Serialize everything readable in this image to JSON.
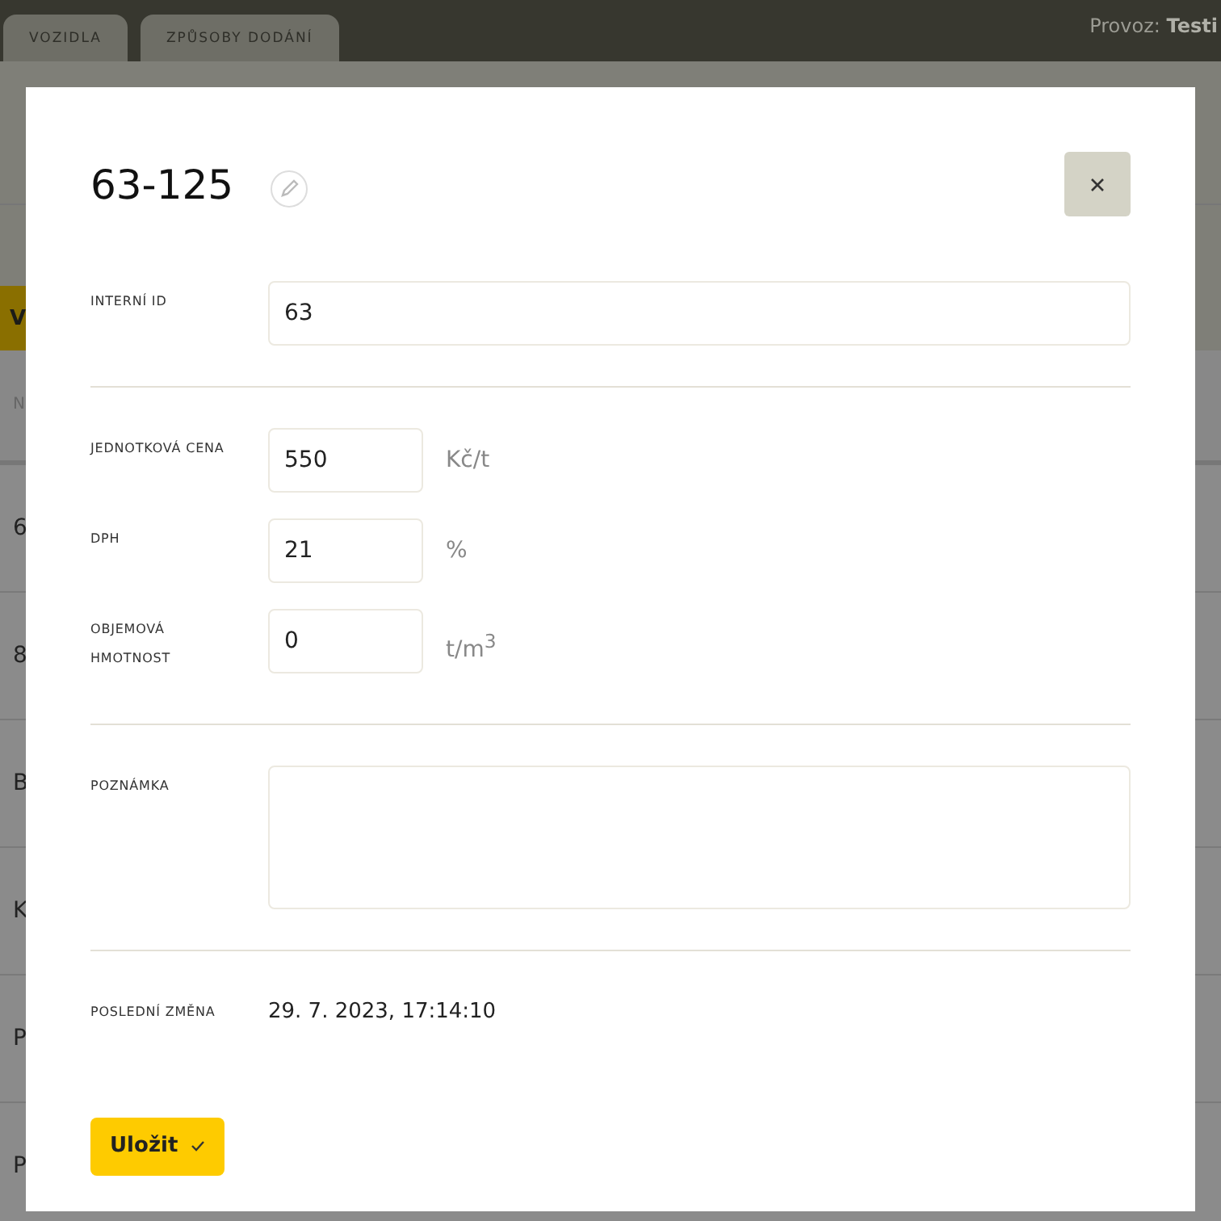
{
  "top_bar": {
    "tabs": [
      {
        "label": "VOZIDLA"
      },
      {
        "label": "ZPŮSOBY DODÁNÍ"
      }
    ],
    "operation_label": "Provoz:",
    "operation_value": "Testi"
  },
  "background": {
    "button": "V",
    "column_1": "N",
    "rows": [
      "6",
      "8",
      "B",
      "K",
      "P",
      "P"
    ]
  },
  "dialog": {
    "title": "63-125",
    "fields": [
      {
        "kind": "wide",
        "label": "INTERNÍ ID",
        "value": "63"
      },
      {
        "kind": "unit",
        "label": "JEDNOTKOVÁ CENA",
        "value": "550",
        "unit": "Kč/t"
      },
      {
        "kind": "unit",
        "label": "DPH",
        "value": "21",
        "unit": "%"
      },
      {
        "kind": "unit",
        "label": "OBJEMOVÁ HMOTNOST",
        "value": "0",
        "unit": "t/m$^{3}$"
      }
    ],
    "note": {
      "label": "POZNÁMKA"
    },
    "last_change": {
      "label": "POSLEDNÍ ZMĚNA",
      "value": "29. 7. 2023, 17:14:10"
    },
    "save_button": "Uložit"
  }
}
